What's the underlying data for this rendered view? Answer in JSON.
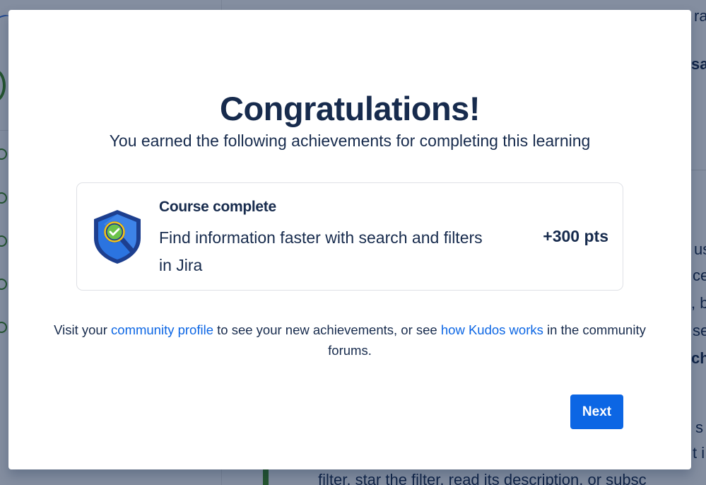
{
  "background": {
    "right_fragments": [
      "ra",
      "sa",
      "us",
      "ce",
      ", b",
      "se",
      "ch",
      "s",
      "t i"
    ],
    "bottom_text": "filter, star the filter, read its description, or subsc"
  },
  "modal": {
    "title": "Congratulations!",
    "subtitle": "You earned the following achievements for completing this learning",
    "achievement": {
      "heading": "Course complete",
      "description": "Find information faster with search and filters in Jira",
      "points": "+300 pts",
      "badge_icon": "shield-magnifier-check-icon"
    },
    "info": {
      "prefix": "Visit your ",
      "link1": "community profile",
      "middle": " to see your new achievements, or see ",
      "link2": "how Kudos works",
      "suffix": " in the community forums."
    },
    "next_label": "Next"
  },
  "colors": {
    "primary": "#0c66e4",
    "text": "#172b4d",
    "badge_navy": "#1d3f8f",
    "badge_blue": "#2b74e0",
    "badge_green": "#6cc24a",
    "badge_yellow": "#f5c518"
  }
}
